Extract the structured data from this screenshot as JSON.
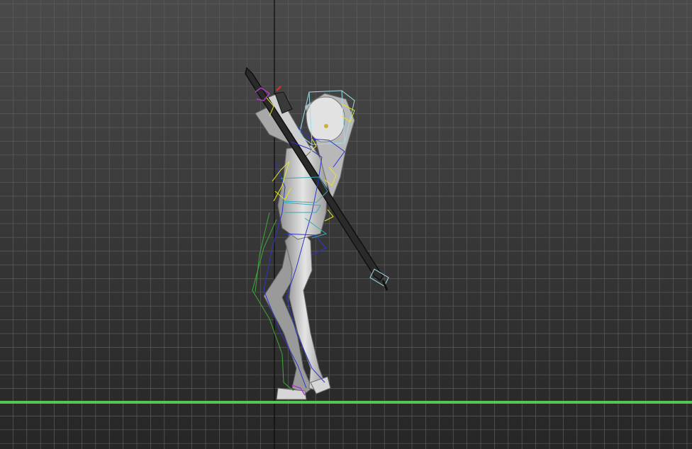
{
  "viewport": {
    "view": "left-orthographic",
    "shading": "default-shading",
    "grid": true,
    "colors": {
      "background_top": "#4a4a4a",
      "background_bottom": "#262626",
      "grid_line": "#5c5c5c",
      "axis_vertical": "#0a0a0a",
      "ground_line": "#55c64f",
      "bone_yellow": "#e8e626",
      "bone_blue": "#2c36c9",
      "bone_green": "#3fa83a",
      "bone_cyan": "#37a8b8",
      "bone_purple": "#b13cc6",
      "bounding_box": "#9fdcea",
      "model_shade": "#c8c8c8"
    }
  },
  "scene": {
    "objects": [
      {
        "name": "character-model",
        "type": "mesh",
        "selected": false
      },
      {
        "name": "sword",
        "type": "mesh",
        "selected": false
      },
      {
        "name": "head-bounding-box",
        "type": "helper",
        "selected": true
      },
      {
        "name": "bone-rig",
        "type": "skeleton",
        "selected": false
      }
    ]
  }
}
